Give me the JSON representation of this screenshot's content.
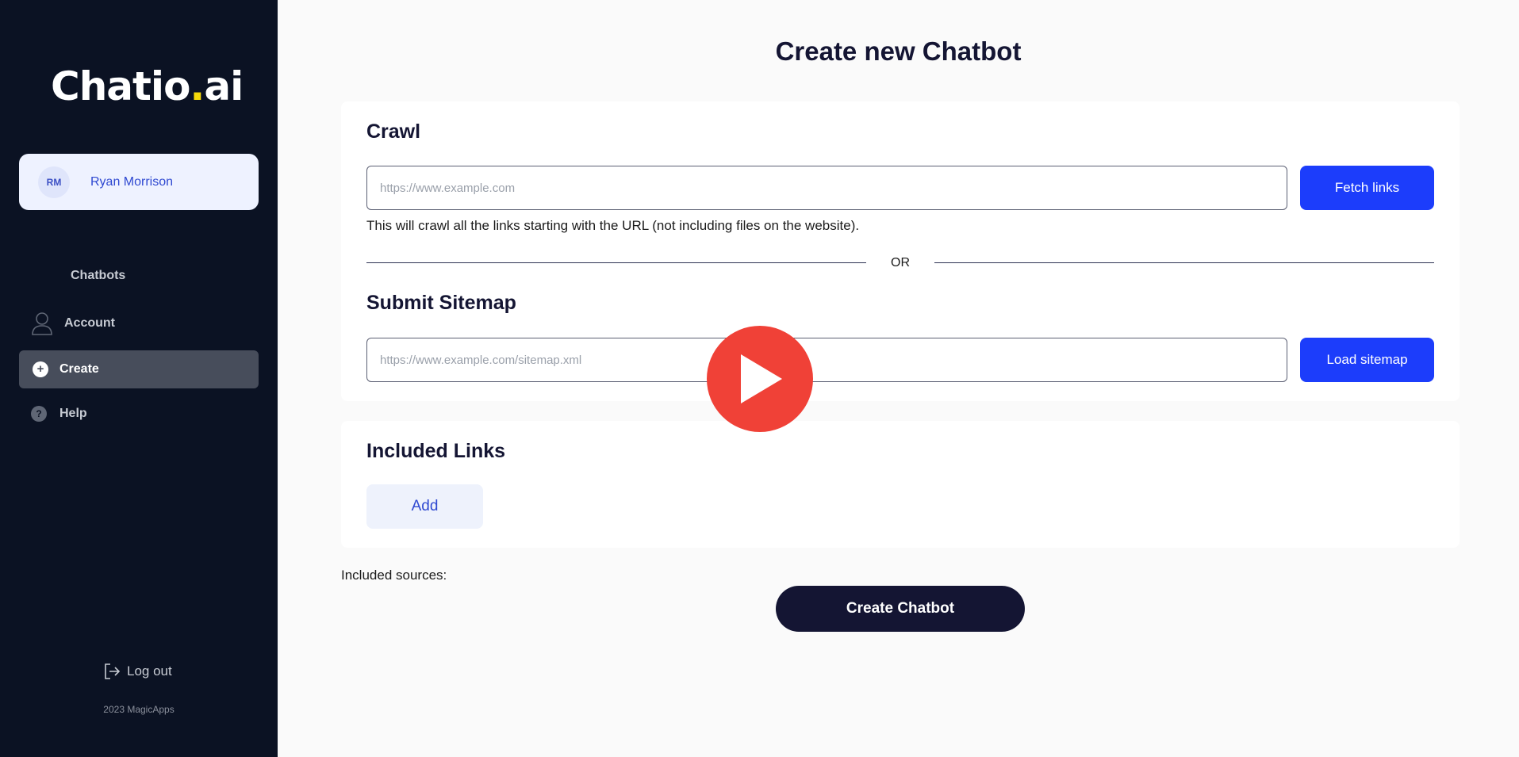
{
  "sidebar": {
    "logo": {
      "text_main": "Chatio",
      "text_dot": ".",
      "text_suffix": "ai"
    },
    "user": {
      "initials": "RM",
      "name": "Ryan Morrison"
    },
    "nav": [
      {
        "label": "Chatbots",
        "icon": "grid-icon",
        "active": false
      },
      {
        "label": "Account",
        "icon": "user-icon",
        "active": false
      },
      {
        "label": "Create",
        "icon": "plus-circle-icon",
        "active": true
      },
      {
        "label": "Help",
        "icon": "question-circle-icon",
        "active": false
      }
    ],
    "logout_label": "Log out",
    "copyright": "2023 MagicApps"
  },
  "main": {
    "title": "Create new Chatbot",
    "crawl": {
      "title": "Crawl",
      "url_placeholder": "https://www.example.com",
      "url_value": "",
      "button_label": "Fetch links",
      "hint": "This will crawl all the links starting with the URL (not including files on the website)."
    },
    "or_label": "OR",
    "sitemap": {
      "title": "Submit Sitemap",
      "url_placeholder": "https://www.example.com/sitemap.xml",
      "url_value": "",
      "button_label": "Load sitemap"
    },
    "included_links": {
      "title": "Included Links",
      "add_label": "Add"
    },
    "sources_label": "Included sources:",
    "create_button_label": "Create Chatbot"
  },
  "overlay": {
    "icon": "play-icon",
    "color": "#f04137"
  },
  "colors": {
    "sidebar_bg": "#0b1223",
    "primary": "#1c3dfb",
    "dark": "#141533",
    "accent_dot": "#f5d90a"
  }
}
